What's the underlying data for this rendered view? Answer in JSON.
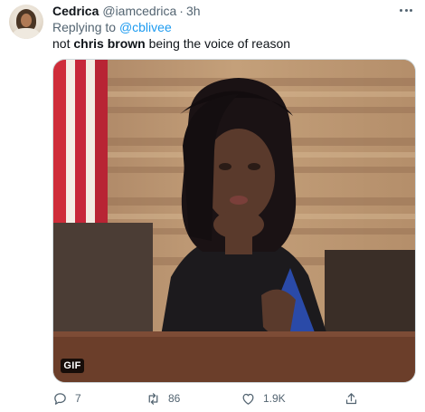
{
  "tweet": {
    "author": {
      "name": "Cedrica",
      "handle": "@iamcedrica",
      "time": "3h"
    },
    "reply_to": {
      "prefix": "Replying to ",
      "handle": "@cblivee"
    },
    "text": {
      "before": "not ",
      "bold": "chris brown",
      "after": " being the voice of reason"
    },
    "media": {
      "badge": "GIF"
    },
    "actions": {
      "reply": {
        "icon": "reply-icon",
        "count": "7"
      },
      "retweet": {
        "icon": "retweet-icon",
        "count": "86"
      },
      "like": {
        "icon": "heart-icon",
        "count": "1.9K"
      },
      "share": {
        "icon": "share-icon"
      }
    },
    "colors": {
      "link": "#1d9bf0",
      "secondary_text": "#536471",
      "primary_text": "#0f1419"
    }
  }
}
